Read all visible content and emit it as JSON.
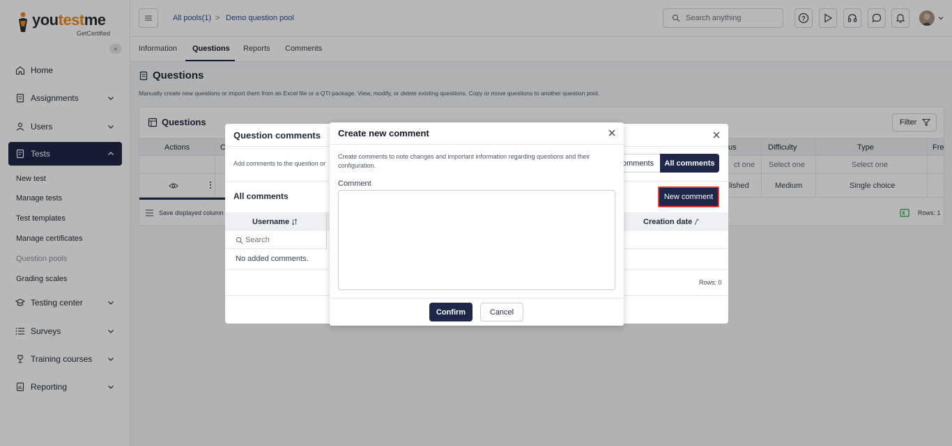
{
  "brand": {
    "logo_main": "you",
    "logo_accent": "test",
    "logo_end": "me",
    "tagline": "GetCertified"
  },
  "sidebar": {
    "collapse": "«",
    "items": [
      {
        "label": "Home"
      },
      {
        "label": "Assignments"
      },
      {
        "label": "Users"
      },
      {
        "label": "Tests"
      },
      {
        "label": "Testing center"
      },
      {
        "label": "Surveys"
      },
      {
        "label": "Training courses"
      },
      {
        "label": "Reporting"
      }
    ],
    "tests_sub": [
      "New test",
      "Manage tests",
      "Test templates",
      "Manage certificates",
      "Question pools",
      "Grading scales"
    ]
  },
  "topbar": {
    "breadcrumb": [
      "All pools(1)",
      "Demo question pool"
    ],
    "separator": ">",
    "search_placeholder": "Search anything"
  },
  "tabs": [
    "Information",
    "Questions",
    "Reports",
    "Comments"
  ],
  "page": {
    "title": "Questions",
    "description": "Manually create new questions or import them from an Excel file or a QTI package. View, modify, or delete existing questions. Copy or move questions to another question pool.",
    "card_title": "Questions",
    "filter_label": "Filter",
    "columns": [
      "Actions",
      "C",
      "us",
      "Difficulty",
      "Type",
      "Fre"
    ],
    "select_placeholder": "Select one",
    "select_partial": "ct one",
    "row": {
      "status_partial": "lished",
      "difficulty": "Medium",
      "type": "Single choice"
    },
    "footer_left": "Save displayed column",
    "footer_rows": "Rows: 1"
  },
  "question_comments": {
    "title": "Question comments",
    "description": "Add comments to the question or",
    "seg_left": "omments",
    "seg_right": "All comments",
    "subtitle": "All comments",
    "new_comment": "New comment",
    "col_username": "Username",
    "col_creation": "Creation date",
    "search_placeholder": "Search",
    "empty": "No added comments.",
    "rows": "Rows: 0"
  },
  "create_comment": {
    "title": "Create new comment",
    "description": "Create comments to note changes and important information regarding questions and their configuration.",
    "label": "Comment",
    "value": "",
    "confirm": "Confirm",
    "cancel": "Cancel"
  }
}
